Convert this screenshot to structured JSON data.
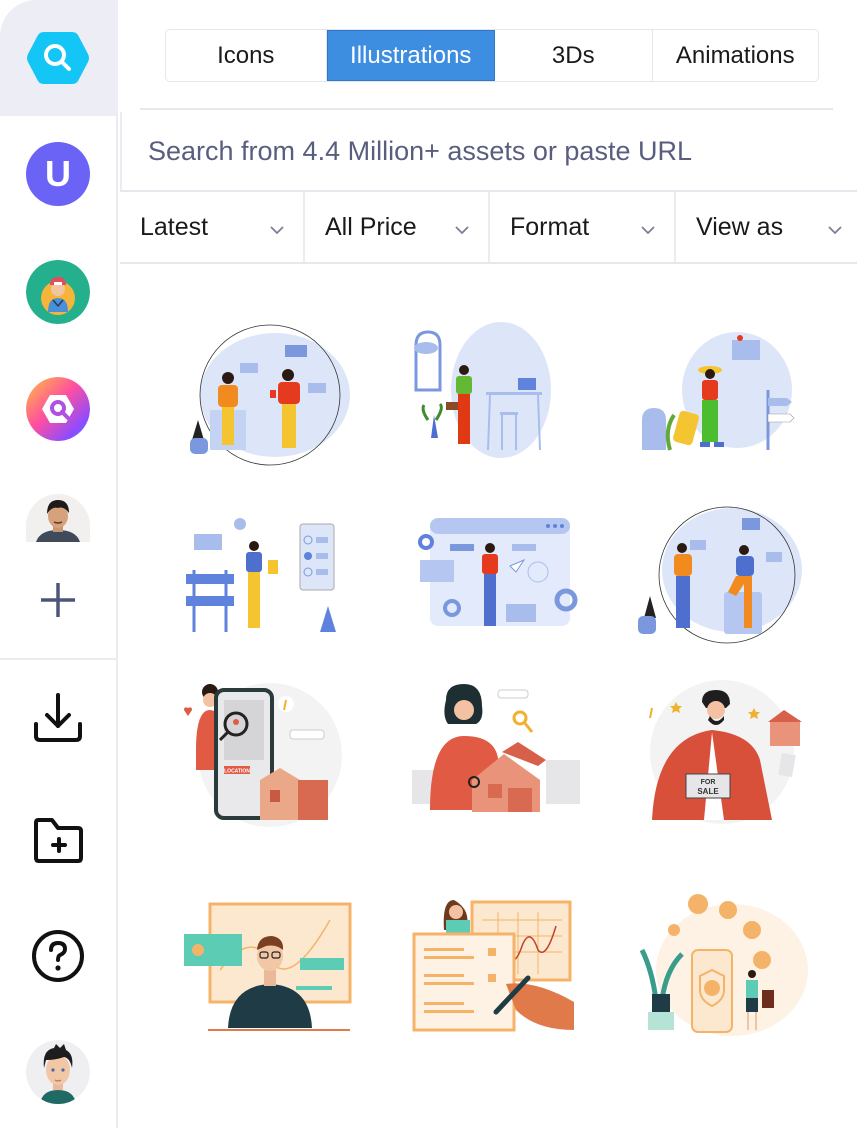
{
  "sidebar": {
    "items": [
      {
        "name": "iconscout-search",
        "label": "Search",
        "active": true
      },
      {
        "name": "unsplash-u",
        "label": "U"
      },
      {
        "name": "character-avatar",
        "label": "Character"
      },
      {
        "name": "gradient-app",
        "label": "App"
      },
      {
        "name": "user-photo",
        "label": "User"
      },
      {
        "name": "add",
        "label": "Add"
      }
    ],
    "bottom": [
      {
        "name": "download",
        "label": "Download"
      },
      {
        "name": "new-folder",
        "label": "New folder"
      },
      {
        "name": "help",
        "label": "Help"
      },
      {
        "name": "profile",
        "label": "Profile"
      }
    ]
  },
  "tabs": [
    {
      "label": "Icons",
      "active": false
    },
    {
      "label": "Illustrations",
      "active": true
    },
    {
      "label": "3Ds",
      "active": false
    },
    {
      "label": "Animations",
      "active": false
    }
  ],
  "search": {
    "placeholder": "Search from 4.4 Million+ assets or paste URL",
    "value": ""
  },
  "filters": [
    {
      "label": "Latest"
    },
    {
      "label": "All Price"
    },
    {
      "label": "Format"
    },
    {
      "label": "View as"
    }
  ],
  "colors": {
    "accent": "#3d8de0",
    "search_logo": "#14c6f5",
    "u_avatar": "#6a63f5",
    "placeholder": "#595e7e"
  },
  "illustrations": [
    {
      "name": "coworkers-chatting",
      "theme": "blue"
    },
    {
      "name": "woman-coffee-desk",
      "theme": "blue"
    },
    {
      "name": "traveler-suitcase",
      "theme": "blue"
    },
    {
      "name": "under-construction-checklist",
      "theme": "blue"
    },
    {
      "name": "web-settings",
      "theme": "blue"
    },
    {
      "name": "people-talking",
      "theme": "blue"
    },
    {
      "name": "property-location-search",
      "theme": "red"
    },
    {
      "name": "woman-house-key",
      "theme": "red"
    },
    {
      "name": "house-for-sale",
      "theme": "red"
    },
    {
      "name": "man-finance-dashboard",
      "theme": "teal-orange"
    },
    {
      "name": "checklist-chart-analysis",
      "theme": "teal-orange"
    },
    {
      "name": "secure-payment-phone",
      "theme": "teal-orange"
    }
  ],
  "labels": {
    "for_sale_1": "FOR",
    "for_sale_2": "SALE",
    "location": "LOCATION"
  }
}
